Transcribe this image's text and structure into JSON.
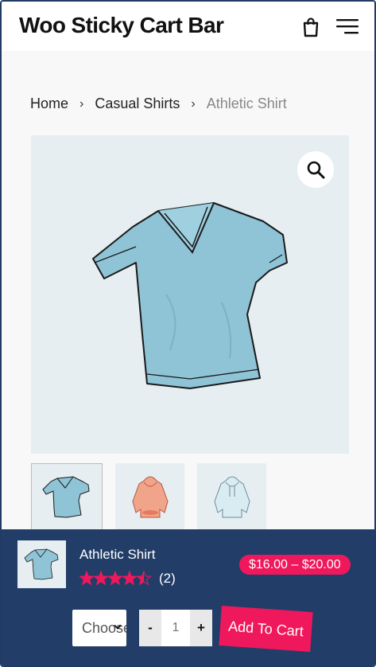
{
  "header": {
    "site_title": "Woo Sticky Cart Bar",
    "cart_icon": "shopping-bag-icon",
    "menu_icon": "hamburger-menu-icon"
  },
  "breadcrumb": {
    "items": [
      "Home",
      "Casual Shirts",
      "Athletic Shirt"
    ],
    "separator": "›"
  },
  "gallery": {
    "zoom_icon": "magnifier-icon",
    "thumbnails": [
      "blue-tshirt",
      "pink-hoodie",
      "light-blue-hoodie"
    ]
  },
  "sticky_bar": {
    "product_title": "Athletic Shirt",
    "rating": 4.5,
    "rating_max": 5,
    "review_count": "(2)",
    "price": "$16.00 – $20.00",
    "select_value": "Choose an option",
    "quantity": "1",
    "minus_label": "-",
    "plus_label": "+",
    "add_to_cart_label": "Add To Cart",
    "colors": {
      "background": "#223e68",
      "accent": "#f0185c"
    }
  }
}
